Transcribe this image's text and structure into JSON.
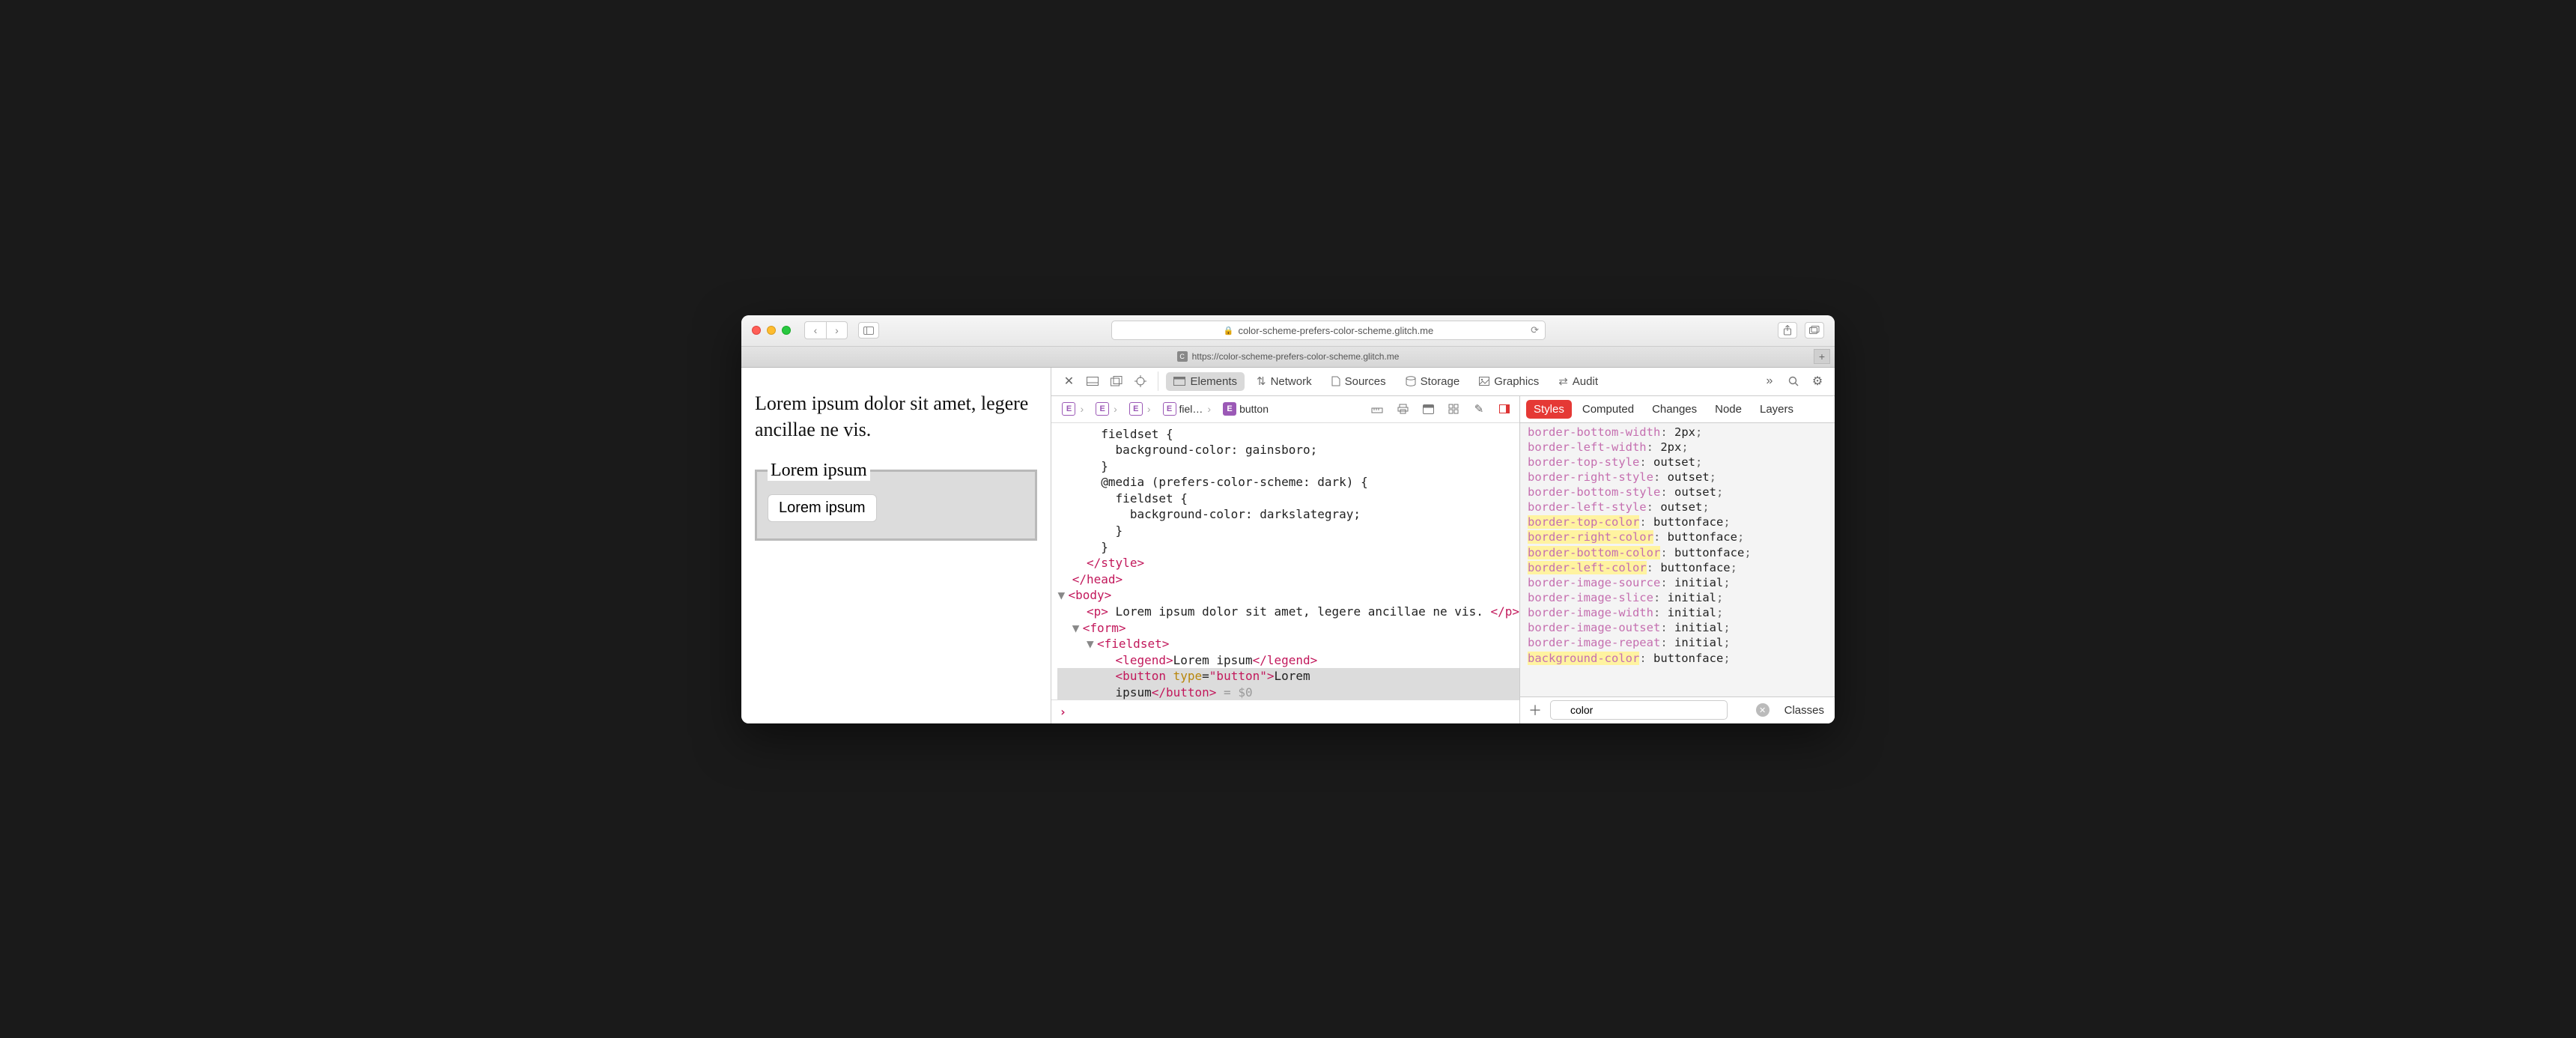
{
  "window": {
    "address_host": "color-scheme-prefers-color-scheme.glitch.me",
    "tab_title": "https://color-scheme-prefers-color-scheme.glitch.me",
    "tab_fav": "C"
  },
  "page": {
    "paragraph": "Lorem ipsum dolor sit amet, legere ancillae ne vis.",
    "legend": "Lorem ipsum",
    "button": "Lorem ipsum"
  },
  "devtools": {
    "tabs": {
      "elements": "Elements",
      "network": "Network",
      "sources": "Sources",
      "storage": "Storage",
      "graphics": "Graphics",
      "audit": "Audit"
    },
    "breadcrumb": {
      "e0": "E",
      "e1": "E",
      "e2": "E",
      "e3_label": "fiel…",
      "e4_label": "button"
    },
    "dom": {
      "l1": "      fieldset {",
      "l2": "        background-color: gainsboro;",
      "l3": "      }",
      "l4": "      @media (prefers-color-scheme: dark) {",
      "l5": "        fieldset {",
      "l6": "          background-color: darkslategray;",
      "l7": "        }",
      "l8": "      }",
      "style_close": "</style>",
      "head_close": "</head>",
      "body_open": "<body>",
      "p_open": "<p>",
      "p_text": " Lorem ipsum dolor sit amet, legere ancillae ne vis. ",
      "p_close": "</p>",
      "form_open": "<form>",
      "fieldset_open": "<fieldset>",
      "legend_open": "<legend>",
      "legend_text": "Lorem ipsum",
      "legend_close": "</legend>",
      "button_open": "<button",
      "button_attr_name": "type",
      "button_attr_val": "\"button\"",
      "button_open_end": ">",
      "button_text1": "Lorem",
      "button_text2": "ipsum",
      "button_close": "</button>",
      "eq0": " = $0"
    },
    "styles": {
      "tabs": {
        "styles": "Styles",
        "computed": "Computed",
        "changes": "Changes",
        "node": "Node",
        "layers": "Layers"
      },
      "props": [
        {
          "name": "border-bottom-width",
          "val": "2px",
          "hl": false
        },
        {
          "name": "border-left-width",
          "val": "2px",
          "hl": false
        },
        {
          "name": "border-top-style",
          "val": "outset",
          "hl": false
        },
        {
          "name": "border-right-style",
          "val": "outset",
          "hl": false
        },
        {
          "name": "border-bottom-style",
          "val": "outset",
          "hl": false
        },
        {
          "name": "border-left-style",
          "val": "outset",
          "hl": false
        },
        {
          "name": "border-top-color",
          "val": "buttonface",
          "hl": true
        },
        {
          "name": "border-right-color",
          "val": "buttonface",
          "hl": true
        },
        {
          "name": "border-bottom-color",
          "val": "buttonface",
          "hl": true
        },
        {
          "name": "border-left-color",
          "val": "buttonface",
          "hl": true
        },
        {
          "name": "border-image-source",
          "val": "initial",
          "hl": false
        },
        {
          "name": "border-image-slice",
          "val": "initial",
          "hl": false
        },
        {
          "name": "border-image-width",
          "val": "initial",
          "hl": false
        },
        {
          "name": "border-image-outset",
          "val": "initial",
          "hl": false
        },
        {
          "name": "border-image-repeat",
          "val": "initial",
          "hl": false
        },
        {
          "name": "background-color",
          "val": "buttonface",
          "hl": true
        }
      ],
      "filter_value": "color",
      "classes_btn": "Classes"
    }
  }
}
